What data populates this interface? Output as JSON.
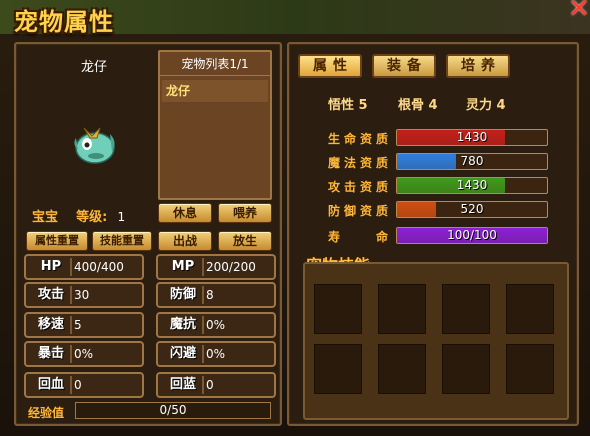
{
  "window": {
    "title": "宠物属性",
    "close_symbol": "✕"
  },
  "pet": {
    "name": "龙仔",
    "tag": "宝宝",
    "level_label": "等级:",
    "level": "1"
  },
  "pet_list": {
    "header": "宠物列表1/1",
    "items": [
      "龙仔"
    ]
  },
  "buttons": {
    "rest": "休息",
    "feed": "喂养",
    "reset_attr": "属性重置",
    "reset_skill": "技能重置",
    "fight": "出战",
    "release": "放生"
  },
  "stats": [
    {
      "key": "HP",
      "value": "400/400"
    },
    {
      "key": "MP",
      "value": "200/200"
    },
    {
      "key": "攻击",
      "value": "30"
    },
    {
      "key": "防御",
      "value": "8"
    },
    {
      "key": "移速",
      "value": "5"
    },
    {
      "key": "魔抗",
      "value": "0%"
    },
    {
      "key": "暴击",
      "value": "0%"
    },
    {
      "key": "闪避",
      "value": "0%"
    },
    {
      "key": "回血",
      "value": "0"
    },
    {
      "key": "回蓝",
      "value": "0"
    }
  ],
  "exp": {
    "label": "经验值",
    "value": "0/50",
    "fraction": 0
  },
  "tabs": [
    "属性",
    "装备",
    "培养"
  ],
  "attributes": {
    "comprehension": "悟性 5",
    "bone": "根骨 4",
    "spirit": "灵力 4"
  },
  "aptitudes": [
    {
      "label": "生命资质",
      "value": "1430",
      "fraction": 0.72,
      "color": "#c4201a"
    },
    {
      "label": "魔法资质",
      "value": "780",
      "fraction": 0.39,
      "color": "#2f7fe0"
    },
    {
      "label": "攻击资质",
      "value": "1430",
      "fraction": 0.72,
      "color": "#3e9a1c"
    },
    {
      "label": "防御资质",
      "value": "520",
      "fraction": 0.26,
      "color": "#d04f12"
    },
    {
      "label": "寿命",
      "value": "100/100",
      "fraction": 1.0,
      "color": "#8b1fd6"
    }
  ],
  "skills": {
    "title": "宠物技能",
    "slot_count": 8
  }
}
